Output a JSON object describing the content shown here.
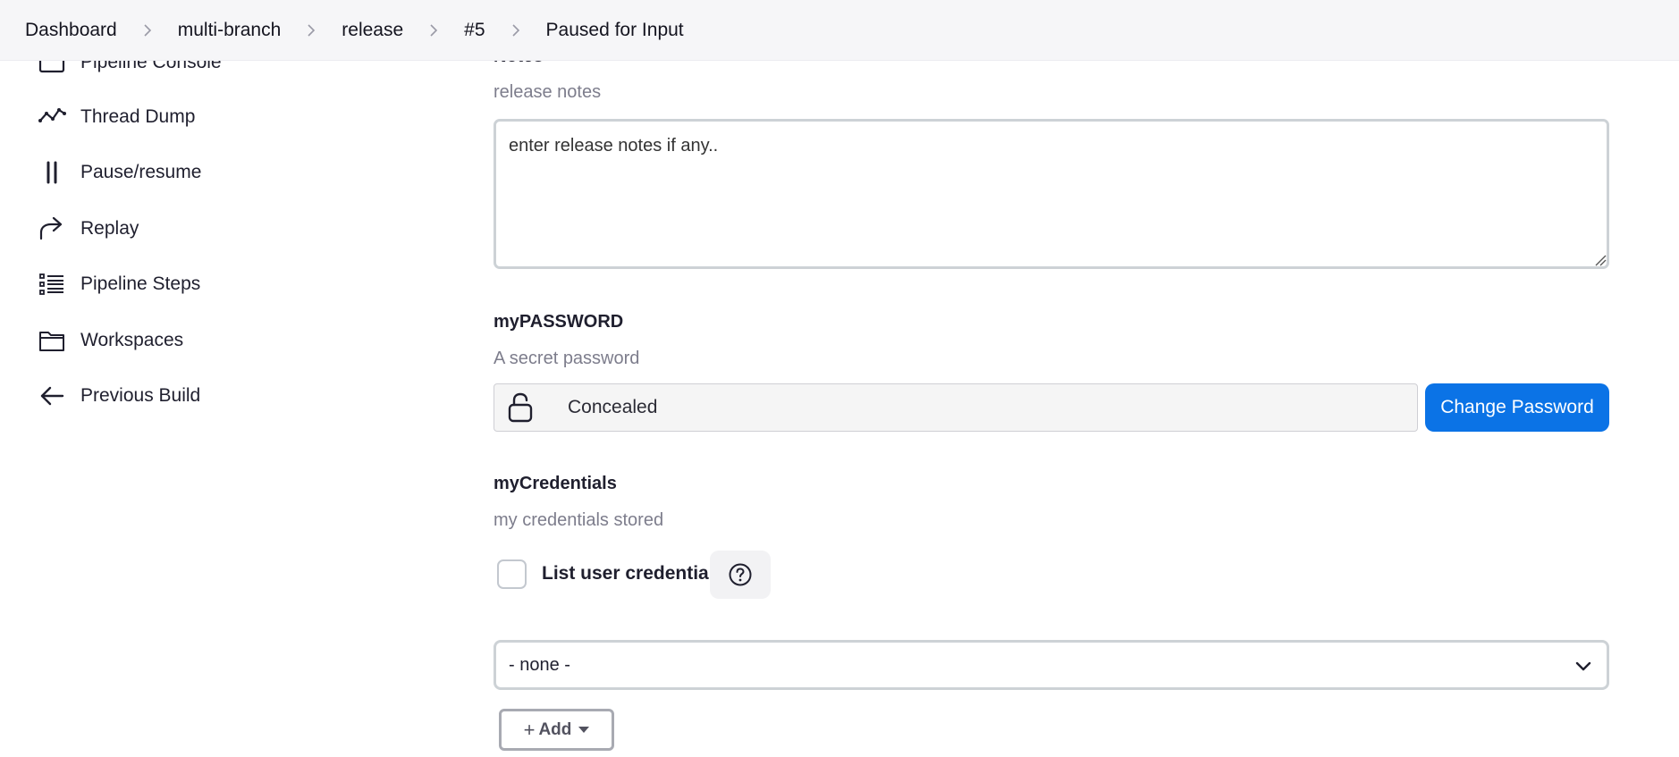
{
  "breadcrumb": {
    "items": [
      "Dashboard",
      "multi-branch",
      "release",
      "#5",
      "Paused for Input"
    ]
  },
  "sidebar": {
    "items": [
      {
        "label": "Pipeline Console",
        "icon": "pipeline-console-icon"
      },
      {
        "label": "Thread Dump",
        "icon": "line-chart-icon"
      },
      {
        "label": "Pause/resume",
        "icon": "pause-icon"
      },
      {
        "label": "Replay",
        "icon": "replay-arrow-icon"
      },
      {
        "label": "Pipeline Steps",
        "icon": "list-steps-icon"
      },
      {
        "label": "Workspaces",
        "icon": "folder-icon"
      },
      {
        "label": "Previous Build",
        "icon": "arrow-left-icon"
      }
    ]
  },
  "form": {
    "notes": {
      "title": "Notes",
      "description": "release notes",
      "value": "enter release notes if any.."
    },
    "password": {
      "title": "myPASSWORD",
      "description": "A secret password",
      "value": "Concealed",
      "button_label": "Change Password"
    },
    "credentials": {
      "title": "myCredentials",
      "description": "my credentials stored",
      "checkbox_label": "List user credentials",
      "select_value": "- none -",
      "add_label": "Add"
    }
  },
  "colors": {
    "accent": "#0b73e6",
    "topbar_bg": "#f6f6f8",
    "muted_text": "#7d7d8c"
  }
}
